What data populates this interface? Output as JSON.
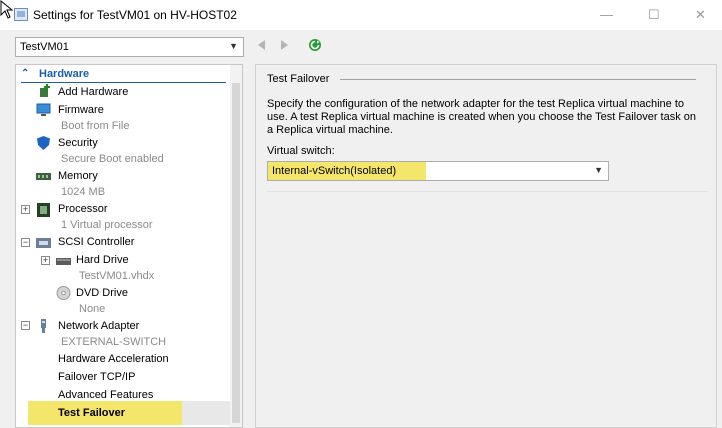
{
  "window": {
    "title": "Settings for TestVM01 on HV-HOST02"
  },
  "toolbar": {
    "vm_selected": "TestVM01"
  },
  "tree": {
    "section": "Hardware",
    "items": [
      {
        "label": "Add Hardware"
      },
      {
        "label": "Firmware",
        "sub": "Boot from File"
      },
      {
        "label": "Security",
        "sub": "Secure Boot enabled"
      },
      {
        "label": "Memory",
        "sub": "1024 MB"
      },
      {
        "label": "Processor",
        "sub": "1 Virtual processor"
      },
      {
        "label": "SCSI Controller"
      },
      {
        "label": "Hard Drive",
        "sub": "TestVM01.vhdx"
      },
      {
        "label": "DVD Drive",
        "sub": "None"
      },
      {
        "label": "Network Adapter",
        "sub": "EXTERNAL-SWITCH"
      },
      {
        "label": "Hardware Acceleration"
      },
      {
        "label": "Failover TCP/IP"
      },
      {
        "label": "Advanced Features"
      },
      {
        "label": "Test Failover"
      }
    ]
  },
  "panel": {
    "title": "Test Failover",
    "description": "Specify the configuration of the network adapter for the test Replica virtual machine to use. A test Replica virtual machine is created when you choose the Test Failover task on a Replica virtual machine.",
    "switch_label": "Virtual switch:",
    "switch_value": "Internal-vSwitch(Isolated)"
  },
  "colors": {
    "accent": "#1a5ea8",
    "highlight": "#f4e56b"
  }
}
